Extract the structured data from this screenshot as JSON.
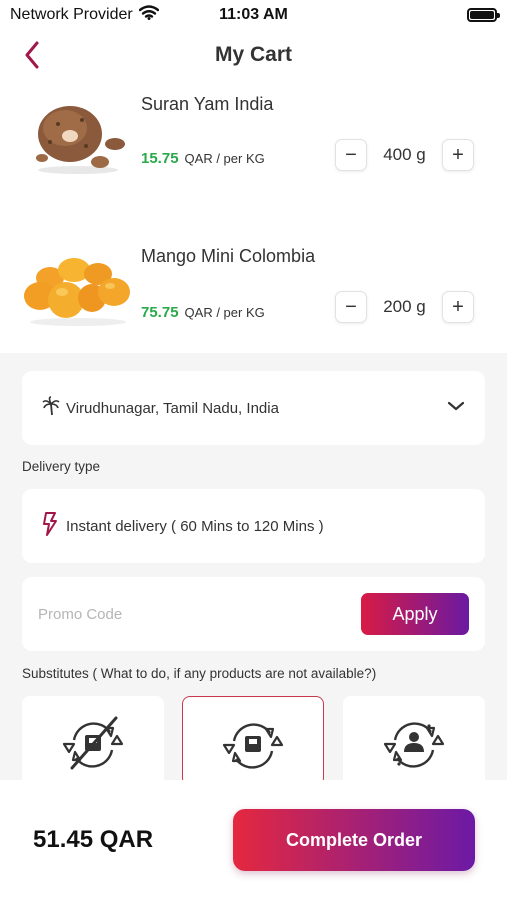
{
  "status_bar": {
    "carrier": "Network Provider",
    "time": "11:03 AM",
    "battery_level": 1.0
  },
  "header": {
    "title": "My Cart",
    "back_icon": "chevron-left-icon"
  },
  "cart_items": [
    {
      "name": "Suran Yam India",
      "price": "15.75",
      "unit": "QAR /  per KG",
      "quantity": "400 g",
      "image": "suran-yam-image"
    },
    {
      "name": "Mango Mini Colombia",
      "price": "75.75",
      "unit": "QAR /  per KG",
      "quantity": "200 g",
      "image": "mango-image"
    }
  ],
  "quantity_controls": {
    "decrease": "−",
    "increase": "+"
  },
  "location": {
    "text": "Virudhunagar, Tamil Nadu, India",
    "icon": "palm-tree-icon"
  },
  "delivery": {
    "label": "Delivery type",
    "text": "Instant delivery ( 60 Mins to 120 Mins )",
    "icon": "lightning-icon"
  },
  "promo": {
    "placeholder": "Promo Code",
    "value": "",
    "apply_label": "Apply"
  },
  "substitutes": {
    "label": "Substitutes ( What to do, if any products are not available?)",
    "options": [
      {
        "icon": "no-substitute-icon",
        "selected": false
      },
      {
        "icon": "substitute-product-icon",
        "selected": true
      },
      {
        "icon": "contact-me-icon",
        "selected": false
      }
    ]
  },
  "footer": {
    "total": "51.45 QAR",
    "complete_label": "Complete Order"
  },
  "colors": {
    "accent": "#a1174a",
    "price_green": "#2aa84a",
    "gradient_start": "#e5283f",
    "gradient_end": "#6b1aa6"
  }
}
